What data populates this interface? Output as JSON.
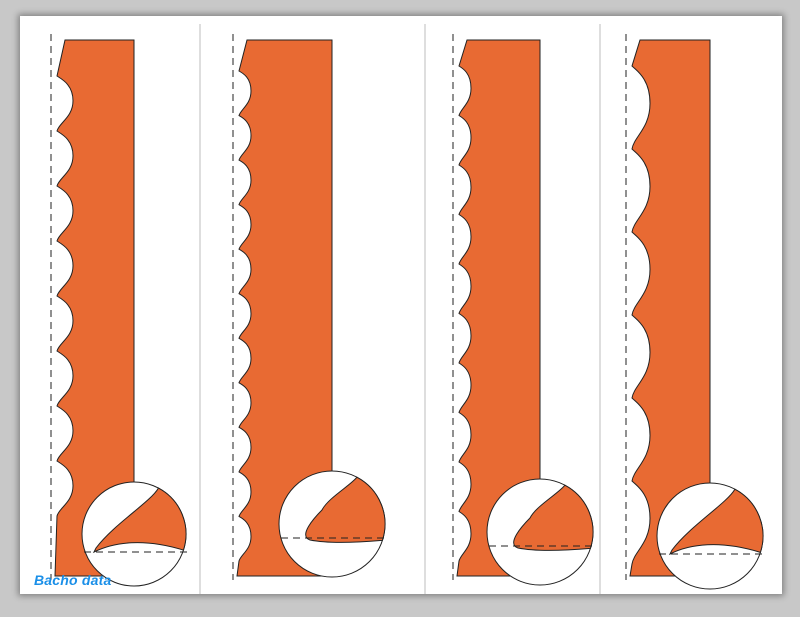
{
  "caption": {
    "source_label": "Bacho data"
  },
  "colors": {
    "blade": "#e86a33",
    "outline": "#222222",
    "page": "#ffffff",
    "background": "#c8c8c8",
    "divider": "#bdbdbd",
    "caption": "#1a8fe8"
  },
  "diagram": {
    "panel_count": 4,
    "panels": [
      {
        "name": "panel-1-tooth-profile",
        "tooth_count": 8
      },
      {
        "name": "panel-2-tooth-profile",
        "tooth_count": 11
      },
      {
        "name": "panel-3-tooth-profile",
        "tooth_count": 10
      },
      {
        "name": "panel-4-tooth-profile",
        "tooth_count": 6
      }
    ]
  }
}
